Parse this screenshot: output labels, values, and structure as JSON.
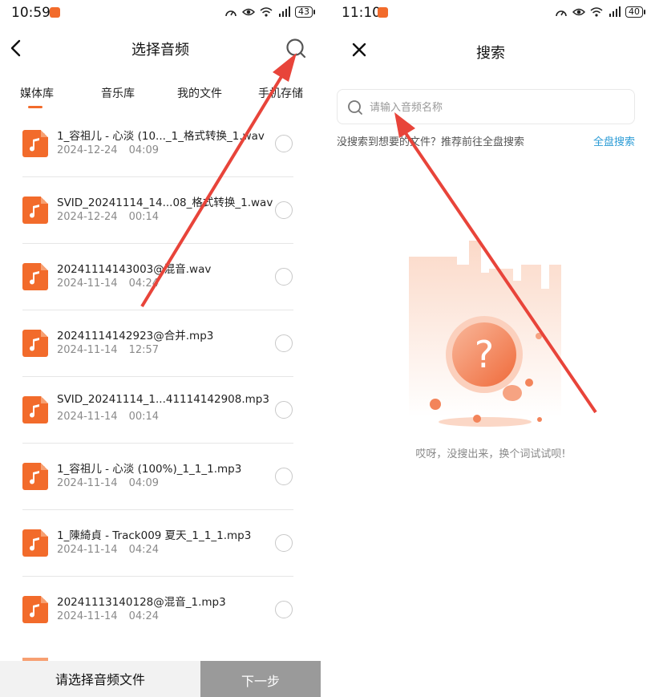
{
  "left": {
    "status": {
      "time": "10:59",
      "battery": "43"
    },
    "header": {
      "title": "选择音频"
    },
    "tabs": [
      "媒体库",
      "音乐库",
      "我的文件",
      "手机存储"
    ],
    "files": [
      {
        "name": "1_容祖儿 - 心淡 (10..._1_格式转换_1.wav",
        "date": "2024-12-24",
        "duration": "04:09"
      },
      {
        "name": "SVID_20241114_14...08_格式转换_1.wav",
        "date": "2024-12-24",
        "duration": "00:14"
      },
      {
        "name": "20241114143003@混音.wav",
        "date": "2024-11-14",
        "duration": "04:24"
      },
      {
        "name": "20241114142923@合并.mp3",
        "date": "2024-11-14",
        "duration": "12:57"
      },
      {
        "name": "SVID_20241114_1...41114142908.mp3",
        "date": "2024-11-14",
        "duration": "00:14"
      },
      {
        "name": "1_容祖儿 - 心淡 (100%)_1_1_1.mp3",
        "date": "2024-11-14",
        "duration": "04:09"
      },
      {
        "name": "1_陳綺貞 - Track009 夏天_1_1_1.mp3",
        "date": "2024-11-14",
        "duration": "04:24"
      },
      {
        "name": "20241113140128@混音_1.mp3",
        "date": "2024-11-14",
        "duration": "04:24"
      }
    ],
    "bottom": {
      "select_label": "请选择音频文件",
      "next_label": "下一步"
    }
  },
  "right": {
    "status": {
      "time": "11:10",
      "battery": "40"
    },
    "header": {
      "title": "搜索"
    },
    "search": {
      "placeholder": "请输入音频名称",
      "value": ""
    },
    "hint": "没搜索到想要的文件？推荐前往全盘搜索",
    "full_search_label": "全盘搜索",
    "empty_message": "哎呀，没搜出来，换个词试试呗!"
  },
  "colors": {
    "accent": "#f26b2b",
    "link": "#2c9cd6",
    "annotation_arrow": "#e8443a"
  },
  "icons": [
    "back-icon",
    "search-icon",
    "close-icon",
    "music-file-icon",
    "radio-icon",
    "question-mark-icon"
  ]
}
